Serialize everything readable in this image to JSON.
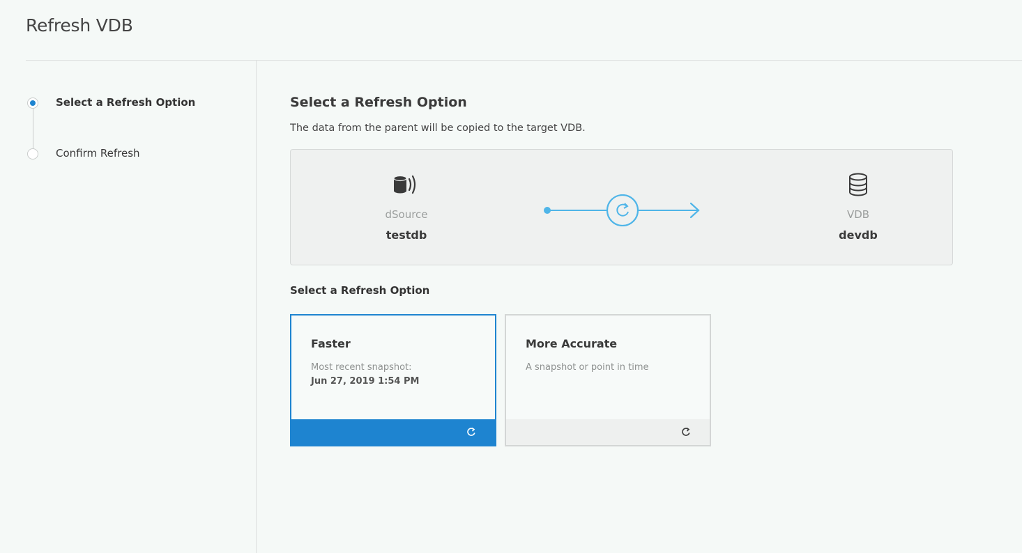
{
  "page": {
    "title": "Refresh VDB"
  },
  "stepper": {
    "steps": [
      {
        "label": "Select a Refresh Option",
        "active": true
      },
      {
        "label": "Confirm Refresh",
        "active": false
      }
    ]
  },
  "main": {
    "title": "Select a Refresh Option",
    "description": "The data from the parent will be copied to the target VDB.",
    "source": {
      "type": "dSource",
      "name": "testdb",
      "icon": "dsource-database-icon"
    },
    "flow_icon": "refresh-arrow-icon",
    "target": {
      "type": "VDB",
      "name": "devdb",
      "icon": "database-icon"
    },
    "options_label": "Select a Refresh Option",
    "options": [
      {
        "title": "Faster",
        "description": "Most recent snapshot:",
        "detail": "Jun 27, 2019 1:54 PM",
        "selected": true,
        "icon": "refresh-icon"
      },
      {
        "title": "More Accurate",
        "description": "A snapshot or point in time",
        "selected": false,
        "icon": "refresh-icon"
      }
    ]
  },
  "colors": {
    "accent": "#1e84d0",
    "flow": "#4fb5e8",
    "background": "#f5f9f7"
  }
}
